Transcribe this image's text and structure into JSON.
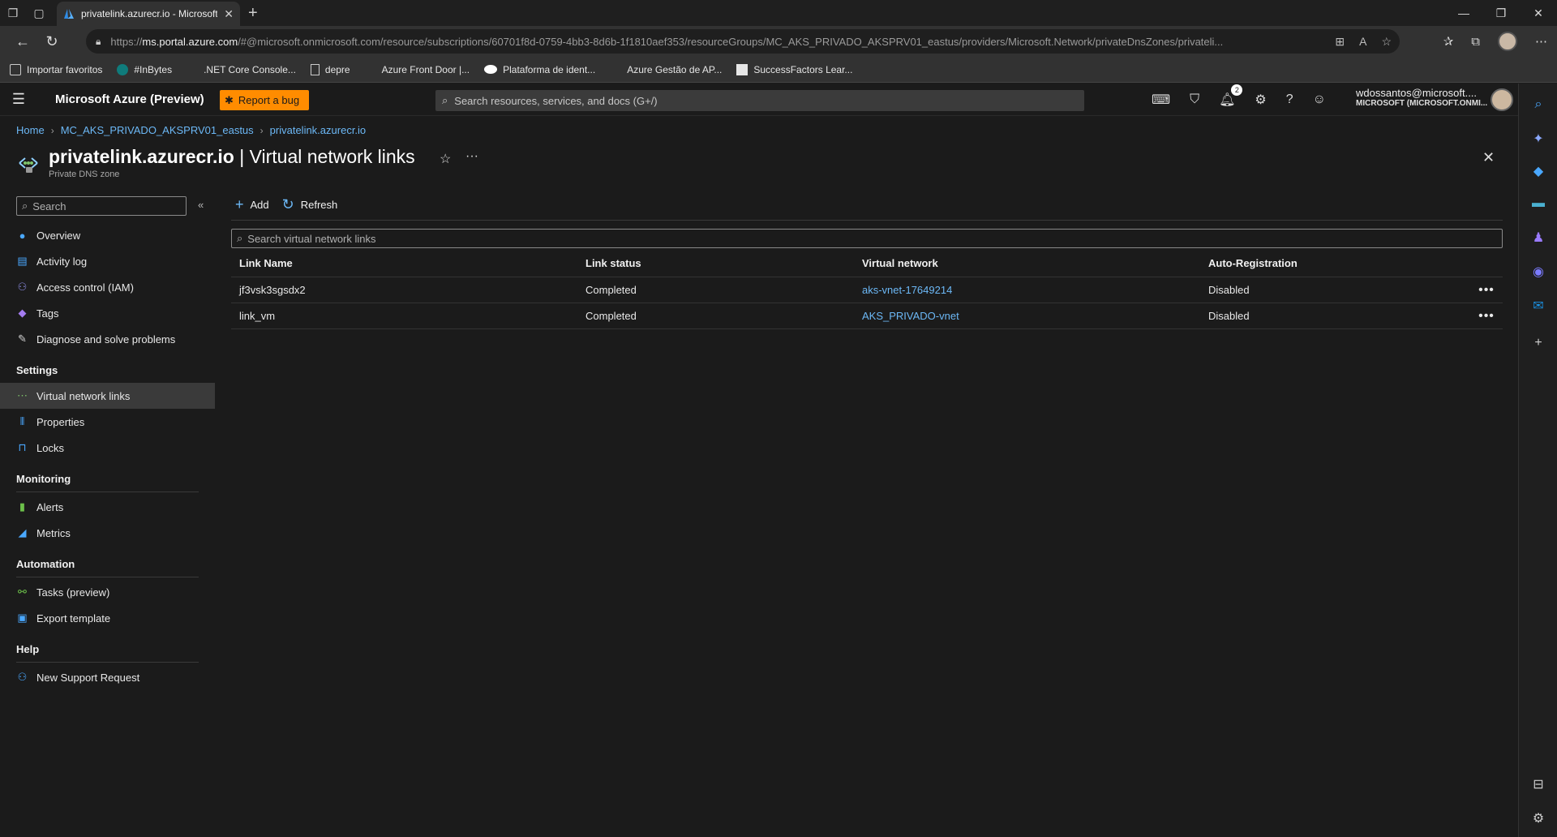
{
  "browser": {
    "tab_title": "privatelink.azurecr.io - Microsoft",
    "url_prefix": "https://",
    "url_host": "ms.portal.azure.com",
    "url_rest": "/#@microsoft.onmicrosoft.com/resource/subscriptions/60701f8d-0759-4bb3-8d6b-1f1810aef353/resourceGroups/MC_AKS_PRIVADO_AKSPRV01_eastus/providers/Microsoft.Network/privateDnsZones/privateli...",
    "bookmarks": [
      {
        "label": "Importar favoritos",
        "icon": "import-icon"
      },
      {
        "label": "#InBytes",
        "icon": "sharepoint-icon"
      },
      {
        "label": ".NET Core Console...",
        "icon": "microsoft-logo"
      },
      {
        "label": "depre",
        "icon": "page-icon"
      },
      {
        "label": "Azure Front Door |...",
        "icon": "microsoft-logo"
      },
      {
        "label": "Plataforma de ident...",
        "icon": "medium-icon"
      },
      {
        "label": "Azure Gestão de AP...",
        "icon": "microsoft-logo"
      },
      {
        "label": "SuccessFactors Lear...",
        "icon": "sap-icon"
      }
    ]
  },
  "portal": {
    "brand": "Microsoft Azure (Preview)",
    "report_bug": "Report a bug",
    "search_placeholder": "Search resources, services, and docs (G+/)",
    "notification_count": "2",
    "user_email": "wdossantos@microsoft....",
    "user_org": "MICROSOFT (MICROSOFT.ONMI..."
  },
  "breadcrumb": [
    "Home",
    "MC_AKS_PRIVADO_AKSPRV01_eastus",
    "privatelink.azurecr.io"
  ],
  "page": {
    "resource_name": "privatelink.azurecr.io",
    "blade_name": "| Virtual network links",
    "resource_type": "Private DNS zone"
  },
  "leftmenu": {
    "search_placeholder": "Search",
    "top_items": [
      {
        "label": "Overview",
        "icon": "overview-icon"
      },
      {
        "label": "Activity log",
        "icon": "activity-log-icon"
      },
      {
        "label": "Access control (IAM)",
        "icon": "iam-icon"
      },
      {
        "label": "Tags",
        "icon": "tag-icon"
      },
      {
        "label": "Diagnose and solve problems",
        "icon": "wrench-icon"
      }
    ],
    "settings_title": "Settings",
    "settings_items": [
      {
        "label": "Virtual network links",
        "icon": "vnet-link-icon"
      },
      {
        "label": "Properties",
        "icon": "properties-icon"
      },
      {
        "label": "Locks",
        "icon": "lock-icon"
      }
    ],
    "monitoring_title": "Monitoring",
    "monitoring_items": [
      {
        "label": "Alerts",
        "icon": "alert-icon"
      },
      {
        "label": "Metrics",
        "icon": "metrics-icon"
      }
    ],
    "automation_title": "Automation",
    "automation_items": [
      {
        "label": "Tasks (preview)",
        "icon": "tasks-icon"
      },
      {
        "label": "Export template",
        "icon": "export-icon"
      }
    ],
    "help_title": "Help",
    "help_items": [
      {
        "label": "New Support Request",
        "icon": "support-icon"
      }
    ]
  },
  "commands": {
    "add": "Add",
    "refresh": "Refresh"
  },
  "table": {
    "search_placeholder": "Search virtual network links",
    "headers": [
      "Link Name",
      "Link status",
      "Virtual network",
      "Auto-Registration"
    ],
    "rows": [
      {
        "name": "jf3vsk3sgsdx2",
        "status": "Completed",
        "vnet": "aks-vnet-17649214",
        "autoreg": "Disabled"
      },
      {
        "name": "link_vm",
        "status": "Completed",
        "vnet": "AKS_PRIVADO-vnet",
        "autoreg": "Disabled"
      }
    ]
  },
  "colors": {
    "accent": "#6cb8f6",
    "bug_button": "#ff8c00",
    "background": "#1b1b1b"
  }
}
